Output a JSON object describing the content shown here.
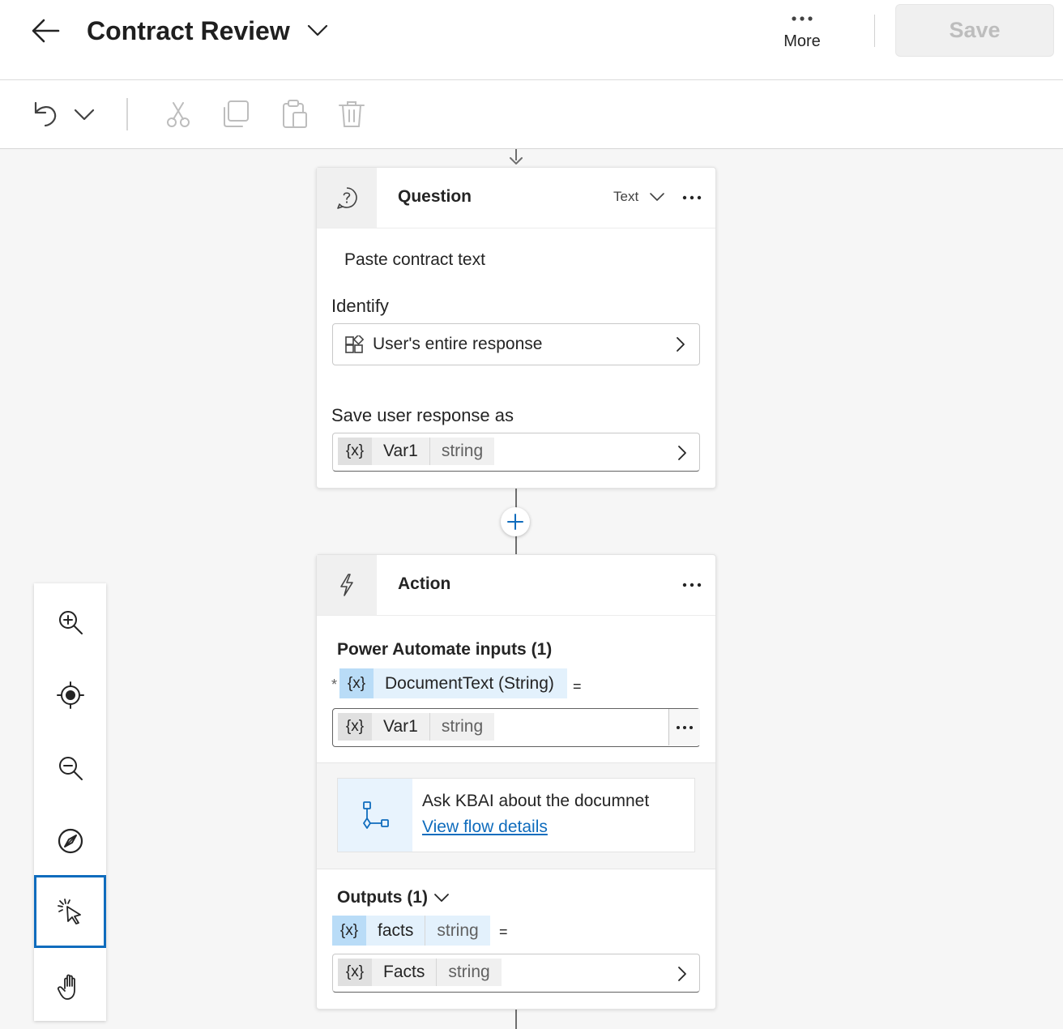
{
  "header": {
    "title": "Contract Review",
    "more_label": "More",
    "save_label": "Save"
  },
  "question_node": {
    "title": "Question",
    "response_type": "Text",
    "prompt": "Paste contract text",
    "identify_label": "Identify",
    "identify_value": "User's entire response",
    "save_as_label": "Save user response as",
    "variable": {
      "badge": "{x}",
      "name": "Var1",
      "type": "string"
    }
  },
  "action_node": {
    "title": "Action",
    "inputs_label": "Power Automate inputs (1)",
    "required_marker": "*",
    "input_param": {
      "badge": "{x}",
      "name": "DocumentText (String)"
    },
    "equals": "=",
    "input_value": {
      "badge": "{x}",
      "name": "Var1",
      "type": "string"
    },
    "flow": {
      "title": "Ask KBAI about the documnet",
      "link": "View flow details"
    },
    "outputs_label": "Outputs (1)",
    "output_param": {
      "badge": "{x}",
      "name": "facts",
      "type": "string"
    },
    "output_value": {
      "badge": "{x}",
      "name": "Facts",
      "type": "string"
    }
  },
  "icons": {
    "toolbar": [
      "undo-icon",
      "chevron-down-icon",
      "cut-icon",
      "copy-icon",
      "paste-icon",
      "delete-icon"
    ],
    "zoom_panel": [
      "zoom-in-icon",
      "recenter-icon",
      "zoom-out-icon",
      "minimap-icon",
      "select-pointer-icon",
      "pan-hand-icon"
    ]
  },
  "colors": {
    "accent": "#0f6cbd",
    "variable_chip_blue": "#e3f1fc",
    "save_disabled_text": "#bdbdbd"
  }
}
